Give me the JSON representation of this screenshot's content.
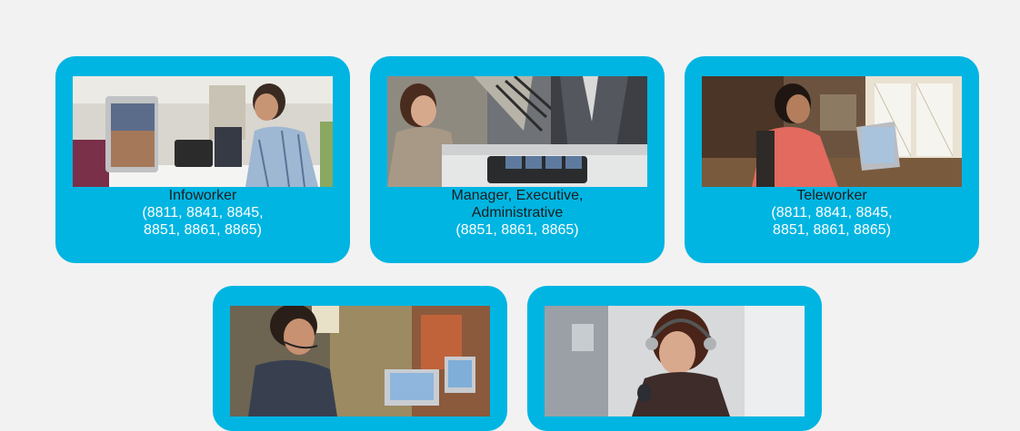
{
  "cards": [
    {
      "name_lines": [
        "Infoworker"
      ],
      "model_lines": [
        "(8811, 8841, 8845,",
        "8851, 8861, 8865)"
      ],
      "image": "office-worker-at-desk-photo"
    },
    {
      "name_lines": [
        "Manager, Executive,",
        "Administrative"
      ],
      "model_lines": [
        "(8851, 8861, 8865)"
      ],
      "image": "reception-desk-photo"
    },
    {
      "name_lines": [
        "Teleworker"
      ],
      "model_lines": [
        "(8811, 8841, 8845,",
        "8851, 8861, 8865)"
      ],
      "image": "home-office-worker-photo"
    },
    {
      "image": "headset-worker-laptop-photo"
    },
    {
      "image": "call-center-agent-photo"
    }
  ],
  "colors": {
    "card_background": "#00b5e2",
    "page_background": "#f2f2f2",
    "name_text": "#1d1d1d",
    "model_text": "#ffffff"
  }
}
